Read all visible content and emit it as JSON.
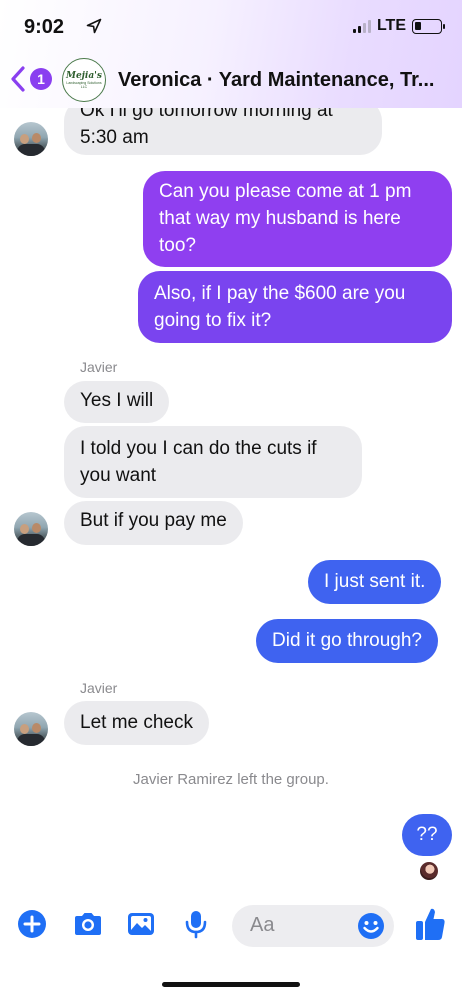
{
  "status": {
    "time": "9:02",
    "network": "LTE"
  },
  "header": {
    "back_count": "1",
    "title": "Veronica · Yard Maintenance, Tr...",
    "logo_text": "Mejia's",
    "logo_subtext": "Landscaping Solutions LLC"
  },
  "messages": [
    {
      "text_line1": "Ok I'll go tomorrow morning at",
      "text_line2": "5:30 am"
    },
    {
      "text_line1": "Can you please come at 1 pm",
      "text_line2": "that way my husband is here",
      "text_line3": "too?"
    },
    {
      "text_line1": "Also, if I pay the $600 are you",
      "text_line2": "going to fix it?"
    },
    {
      "sender": "Javier"
    },
    {
      "text": "Yes I will"
    },
    {
      "text_line1": "I told you I can do the cuts if",
      "text_line2": "you want"
    },
    {
      "text": "But if you pay me"
    },
    {
      "text": "I just sent it."
    },
    {
      "text": "Did it go through?"
    },
    {
      "sender": "Javier"
    },
    {
      "text": "Let me check"
    },
    {
      "system": "Javier Ramirez left the group."
    },
    {
      "text": "??"
    }
  ],
  "composer": {
    "placeholder": "Aa"
  },
  "colors": {
    "accent_purple": "#8f3ff0",
    "accent_blue": "#3f63f0",
    "icon_blue": "#1f6ff5"
  },
  "icons": [
    "location-arrow-icon",
    "signal-icon",
    "battery-icon",
    "back-chevron-icon",
    "plus-icon",
    "camera-icon",
    "photo-icon",
    "microphone-icon",
    "emoji-icon",
    "thumbs-up-icon"
  ]
}
